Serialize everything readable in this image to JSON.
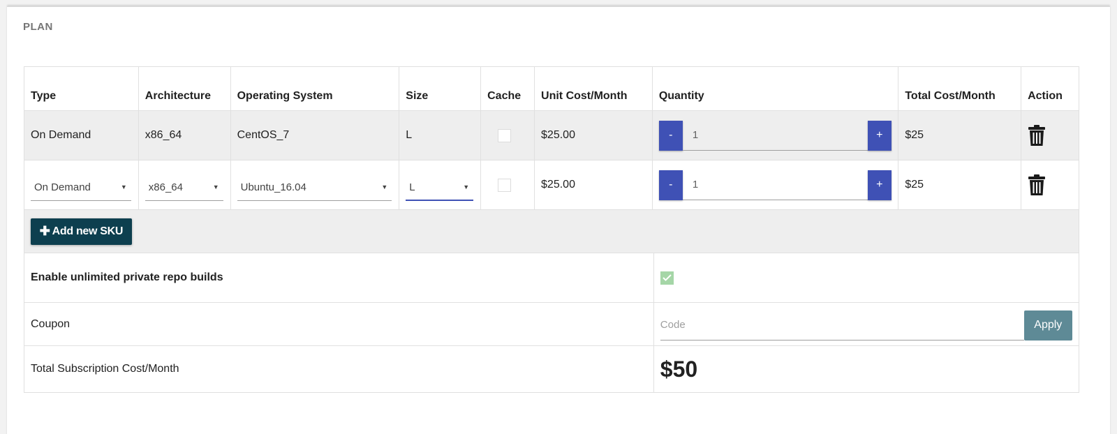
{
  "section_title": "PLAN",
  "columns": [
    "Type",
    "Architecture",
    "Operating System",
    "Size",
    "Cache",
    "Unit Cost/Month",
    "Quantity",
    "Total Cost/Month",
    "Action"
  ],
  "rows": [
    {
      "type": "On Demand",
      "architecture": "x86_64",
      "os": "CentOS_7",
      "size": "L",
      "cache_checked": false,
      "unit_cost": "$25.00",
      "quantity": "1",
      "total_cost": "$25"
    },
    {
      "type": "On Demand",
      "architecture": "x86_64",
      "os": "Ubuntu_16.04",
      "size": "L",
      "cache_checked": false,
      "unit_cost": "$25.00",
      "quantity": "1",
      "total_cost": "$25"
    }
  ],
  "controls": {
    "decrement_label": "-",
    "increment_label": "+",
    "dropdown_arrow": "▼"
  },
  "add_sku": {
    "icon": "plus-icon",
    "plus_glyph": "✚",
    "label": "Add new SKU"
  },
  "private_repo": {
    "label": "Enable unlimited private repo builds",
    "checked": true
  },
  "coupon": {
    "label": "Coupon",
    "placeholder": "Code",
    "apply_label": "Apply"
  },
  "total": {
    "label": "Total Subscription Cost/Month",
    "value": "$50"
  },
  "colors": {
    "accent": "#3f51b5",
    "add_button": "#0d3f4f",
    "apply_button": "#5e8a96",
    "check_green": "#a5d6a7"
  }
}
